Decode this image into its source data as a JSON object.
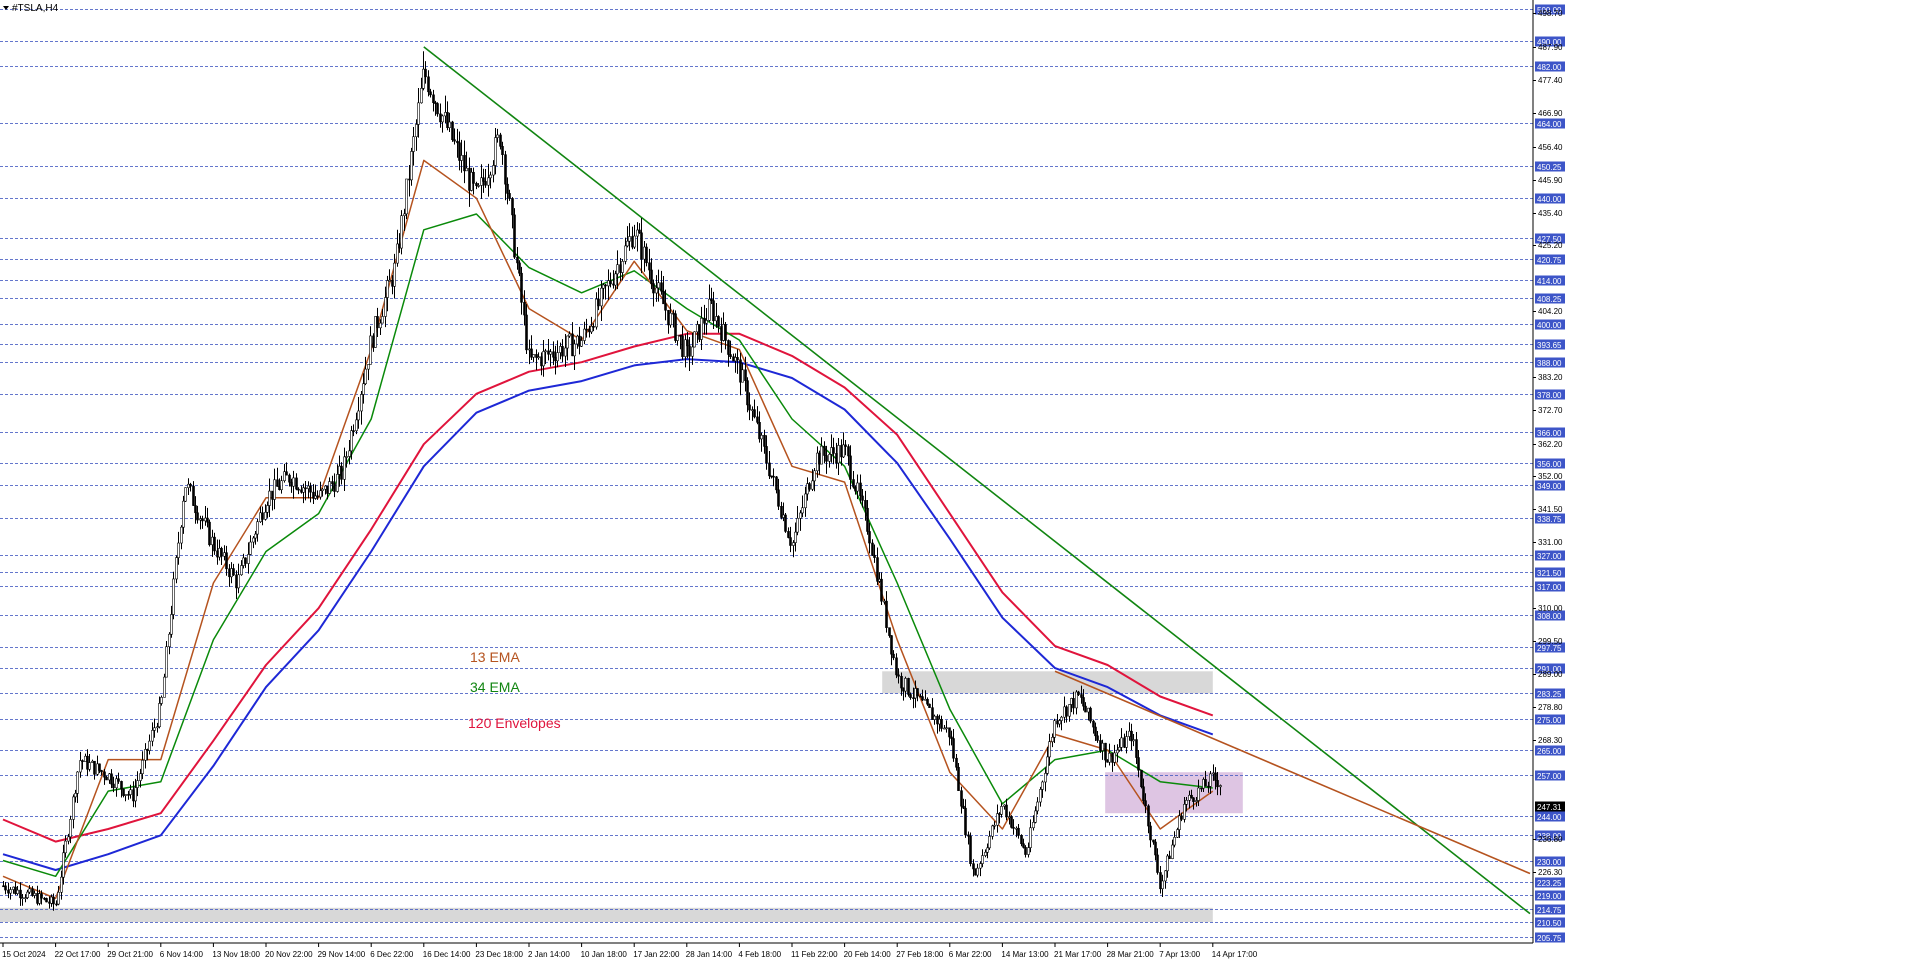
{
  "window_title": "#TSLA,H4",
  "colors": {
    "ema13": "#b5531f",
    "ema34": "#0a8a0a",
    "env_upper": "#e0143c",
    "env_lower": "#1e28d6",
    "trend": "#118511",
    "grid": "#4a5fc4",
    "label_bg": "#3d55c8",
    "candle": "#000000",
    "zone": "#d8d8d8",
    "box": "#d6b6dc"
  },
  "legend": {
    "ema13": "13 EMA",
    "ema34": "34 EMA",
    "env": "120 Envelopes"
  },
  "chart_data": {
    "type": "candlestick",
    "symbol": "#TSLA",
    "timeframe": "H4",
    "ylim": [
      205.75,
      500.0
    ],
    "current_price": "247.31",
    "x_ticks": [
      "15 Oct 2024",
      "22 Oct 17:00",
      "29 Oct 21:00",
      "6 Nov 14:00",
      "13 Nov 18:00",
      "20 Nov 22:00",
      "29 Nov 14:00",
      "6 Dec 22:00",
      "16 Dec 14:00",
      "23 Dec 18:00",
      "2 Jan 14:00",
      "10 Jan 18:00",
      "17 Jan 22:00",
      "28 Jan 14:00",
      "4 Feb 18:00",
      "11 Feb 22:00",
      "20 Feb 14:00",
      "27 Feb 18:00",
      "6 Mar 22:00",
      "14 Mar 13:00",
      "21 Mar 17:00",
      "28 Mar 21:00",
      "7 Apr 13:00",
      "14 Apr 17:00"
    ],
    "level_lines": [
      "500.00",
      "490.00",
      "482.00",
      "464.00",
      "450.25",
      "440.00",
      "427.50",
      "420.75",
      "414.00",
      "408.25",
      "400.00",
      "393.65",
      "388.00",
      "378.00",
      "366.00",
      "356.00",
      "349.00",
      "338.75",
      "327.00",
      "321.50",
      "317.00",
      "308.00",
      "297.75",
      "291.00",
      "283.25",
      "275.00",
      "265.00",
      "257.00",
      "244.00",
      "238.00",
      "230.00",
      "223.25",
      "219.00",
      "214.75",
      "210.50",
      "205.75"
    ],
    "scale_labels": [
      "498.70",
      "487.90",
      "477.40",
      "466.90",
      "456.40",
      "445.90",
      "435.40",
      "425.20",
      "404.20",
      "383.20",
      "372.70",
      "362.20",
      "352.00",
      "341.50",
      "331.00",
      "310.00",
      "299.50",
      "289.00",
      "278.80",
      "268.30",
      "236.80",
      "226.30"
    ],
    "price_path": [
      [
        "15 Oct 2024",
        222
      ],
      [
        "22 Oct 17:00",
        216
      ],
      [
        "22 Oct 17:00",
        262
      ],
      [
        "29 Oct 21:00",
        257
      ],
      [
        "29 Oct 21:00",
        250
      ],
      [
        "6 Nov 14:00",
        279
      ],
      [
        "6 Nov 14:00",
        350
      ],
      [
        "13 Nov 18:00",
        330
      ],
      [
        "13 Nov 18:00",
        318
      ],
      [
        "20 Nov 22:00",
        345
      ],
      [
        "20 Nov 22:00",
        352
      ],
      [
        "29 Nov 14:00",
        345
      ],
      [
        "29 Nov 14:00",
        353
      ],
      [
        "6 Dec 22:00",
        395
      ],
      [
        "6 Dec 22:00",
        418
      ],
      [
        "16 Dec 14:00",
        480
      ],
      [
        "23 Dec 18:00",
        440
      ],
      [
        "23 Dec 18:00",
        460
      ],
      [
        "2 Jan 14:00",
        388
      ],
      [
        "10 Jan 18:00",
        395
      ],
      [
        "17 Jan 22:00",
        430
      ],
      [
        "17 Jan 22:00",
        410
      ],
      [
        "28 Jan 14:00",
        390
      ],
      [
        "28 Jan 14:00",
        406
      ],
      [
        "4 Feb 18:00",
        385
      ],
      [
        "11 Feb 22:00",
        330
      ],
      [
        "11 Feb 22:00",
        358
      ],
      [
        "20 Feb 14:00",
        360
      ],
      [
        "20 Feb 14:00",
        335
      ],
      [
        "27 Feb 18:00",
        288
      ],
      [
        "6 Mar 22:00",
        270
      ],
      [
        "6 Mar 22:00",
        225
      ],
      [
        "14 Mar 13:00",
        248
      ],
      [
        "14 Mar 13:00",
        232
      ],
      [
        "21 Mar 17:00",
        275
      ],
      [
        "21 Mar 17:00",
        282
      ],
      [
        "28 Mar 21:00",
        262
      ],
      [
        "28 Mar 21:00",
        270
      ],
      [
        "7 Apr 13:00",
        222
      ],
      [
        "7 Apr 13:00",
        248
      ],
      [
        "14 Apr 17:00",
        256
      ],
      [
        "14 Apr 17:00",
        252
      ]
    ],
    "ema13_path": [
      [
        "15 Oct 2024",
        225
      ],
      [
        "22 Oct 17:00",
        218
      ],
      [
        "29 Oct 21:00",
        262
      ],
      [
        "6 Nov 14:00",
        262
      ],
      [
        "13 Nov 18:00",
        318
      ],
      [
        "20 Nov 22:00",
        345
      ],
      [
        "29 Nov 14:00",
        345
      ],
      [
        "6 Dec 22:00",
        392
      ],
      [
        "16 Dec 14:00",
        452
      ],
      [
        "23 Dec 18:00",
        440
      ],
      [
        "2 Jan 14:00",
        405
      ],
      [
        "10 Jan 18:00",
        395
      ],
      [
        "17 Jan 22:00",
        420
      ],
      [
        "28 Jan 14:00",
        398
      ],
      [
        "4 Feb 18:00",
        392
      ],
      [
        "11 Feb 22:00",
        355
      ],
      [
        "20 Feb 14:00",
        350
      ],
      [
        "27 Feb 18:00",
        300
      ],
      [
        "6 Mar 22:00",
        258
      ],
      [
        "14 Mar 13:00",
        240
      ],
      [
        "21 Mar 17:00",
        270
      ],
      [
        "28 Mar 21:00",
        265
      ],
      [
        "7 Apr 13:00",
        240
      ],
      [
        "14 Apr 17:00",
        252
      ]
    ],
    "ema34_path": [
      [
        "15 Oct 2024",
        230
      ],
      [
        "22 Oct 17:00",
        225
      ],
      [
        "29 Oct 21:00",
        252
      ],
      [
        "6 Nov 14:00",
        255
      ],
      [
        "13 Nov 18:00",
        300
      ],
      [
        "20 Nov 22:00",
        328
      ],
      [
        "29 Nov 14:00",
        340
      ],
      [
        "6 Dec 22:00",
        370
      ],
      [
        "16 Dec 14:00",
        430
      ],
      [
        "23 Dec 18:00",
        435
      ],
      [
        "2 Jan 14:00",
        418
      ],
      [
        "10 Jan 18:00",
        410
      ],
      [
        "17 Jan 22:00",
        417
      ],
      [
        "28 Jan 14:00",
        405
      ],
      [
        "4 Feb 18:00",
        395
      ],
      [
        "11 Feb 22:00",
        370
      ],
      [
        "20 Feb 14:00",
        355
      ],
      [
        "27 Feb 18:00",
        318
      ],
      [
        "6 Mar 22:00",
        278
      ],
      [
        "14 Mar 13:00",
        248
      ],
      [
        "21 Mar 17:00",
        262
      ],
      [
        "28 Mar 21:00",
        265
      ],
      [
        "7 Apr 13:00",
        255
      ],
      [
        "14 Apr 17:00",
        253
      ]
    ],
    "env_upper_path": [
      [
        "15 Oct 2024",
        243
      ],
      [
        "22 Oct 17:00",
        236
      ],
      [
        "29 Oct 21:00",
        240
      ],
      [
        "6 Nov 14:00",
        245
      ],
      [
        "13 Nov 18:00",
        268
      ],
      [
        "20 Nov 22:00",
        292
      ],
      [
        "29 Nov 14:00",
        310
      ],
      [
        "6 Dec 22:00",
        335
      ],
      [
        "16 Dec 14:00",
        362
      ],
      [
        "23 Dec 18:00",
        378
      ],
      [
        "2 Jan 14:00",
        385
      ],
      [
        "10 Jan 18:00",
        388
      ],
      [
        "17 Jan 22:00",
        393
      ],
      [
        "28 Jan 14:00",
        397
      ],
      [
        "4 Feb 18:00",
        397
      ],
      [
        "11 Feb 22:00",
        390
      ],
      [
        "20 Feb 14:00",
        380
      ],
      [
        "27 Feb 18:00",
        365
      ],
      [
        "6 Mar 22:00",
        340
      ],
      [
        "14 Mar 13:00",
        315
      ],
      [
        "21 Mar 17:00",
        298
      ],
      [
        "28 Mar 21:00",
        292
      ],
      [
        "7 Apr 13:00",
        282
      ],
      [
        "14 Apr 17:00",
        276
      ]
    ],
    "env_lower_path": [
      [
        "15 Oct 2024",
        232
      ],
      [
        "22 Oct 17:00",
        227
      ],
      [
        "29 Oct 21:00",
        232
      ],
      [
        "6 Nov 14:00",
        238
      ],
      [
        "13 Nov 18:00",
        260
      ],
      [
        "20 Nov 22:00",
        285
      ],
      [
        "29 Nov 14:00",
        303
      ],
      [
        "6 Dec 22:00",
        328
      ],
      [
        "16 Dec 14:00",
        355
      ],
      [
        "23 Dec 18:00",
        372
      ],
      [
        "2 Jan 14:00",
        379
      ],
      [
        "10 Jan 18:00",
        382
      ],
      [
        "17 Jan 22:00",
        387
      ],
      [
        "28 Jan 14:00",
        389
      ],
      [
        "4 Feb 18:00",
        388
      ],
      [
        "11 Feb 22:00",
        383
      ],
      [
        "20 Feb 14:00",
        373
      ],
      [
        "27 Feb 18:00",
        356
      ],
      [
        "6 Mar 22:00",
        332
      ],
      [
        "14 Mar 13:00",
        307
      ],
      [
        "21 Mar 17:00",
        291
      ],
      [
        "28 Mar 21:00",
        285
      ],
      [
        "7 Apr 13:00",
        276
      ],
      [
        "14 Apr 17:00",
        270
      ]
    ],
    "trendlines": [
      {
        "color": "trend",
        "from": [
          "16 Dec 14:00",
          488
        ],
        "to": [
          "14 Apr 17:00",
          287
        ],
        "extends_right": true
      },
      {
        "color": "ema13",
        "from": [
          "21 Mar 17:00",
          290
        ],
        "to": [
          "14 Apr 17:00",
          266
        ],
        "extends_right": true
      }
    ],
    "zones": [
      {
        "from": "27 Feb 18:00",
        "to": "14 Apr 17:00",
        "price_top": 290,
        "price_bottom": 283
      },
      {
        "from": "15 Oct 2024",
        "to": "14 Apr 17:00",
        "price_top": 215,
        "price_bottom": 210.5
      }
    ],
    "box": {
      "from": "7 Apr 13:00",
      "to": "14 Apr 17:00",
      "price_top": 258,
      "price_bottom": 245
    }
  }
}
